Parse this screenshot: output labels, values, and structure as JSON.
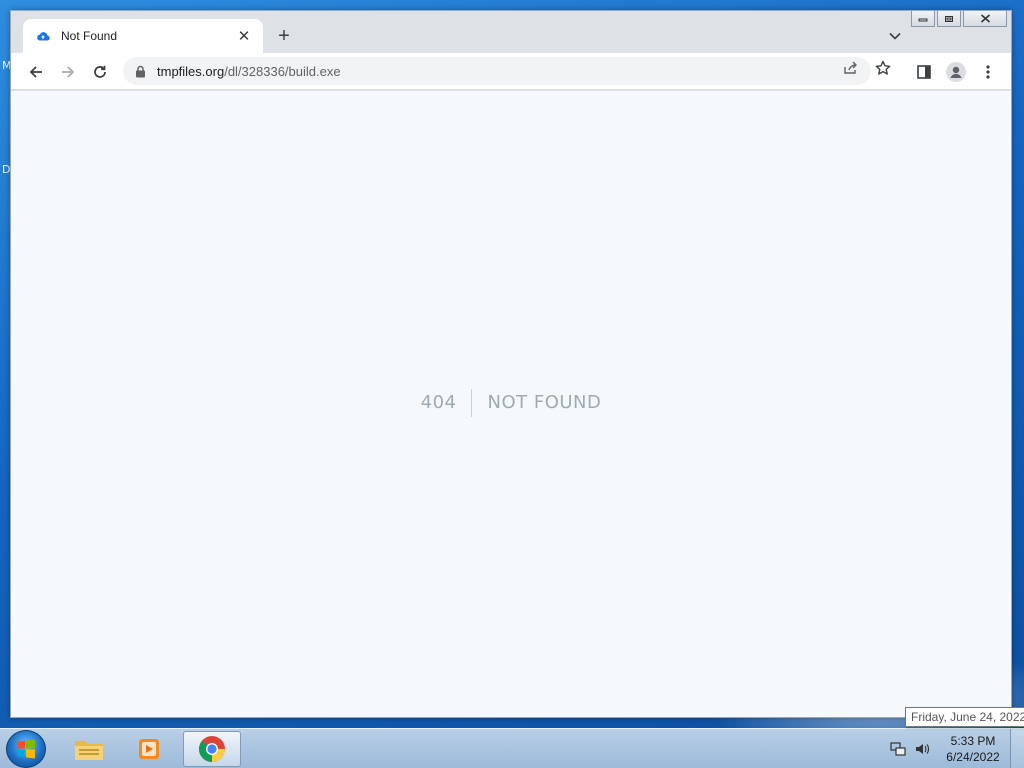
{
  "desktop": {
    "edge_text_1": "M",
    "edge_text_2": "D"
  },
  "browser": {
    "tab": {
      "title": "Not Found",
      "close_glyph": "✕",
      "favicon": "cloud-favicon-icon"
    },
    "new_tab_glyph": "+",
    "window_controls": [
      "minimize",
      "restore",
      "close"
    ],
    "omnibox": {
      "host": "tmpfiles.org",
      "path": "/dl/328336/build.exe"
    },
    "accent": "#1a73e8"
  },
  "page": {
    "code": "404",
    "message": "NOT FOUND"
  },
  "taskbar": {
    "items": [
      "start",
      "file-explorer",
      "media-player",
      "chrome"
    ],
    "active_item": "chrome",
    "clock": {
      "time": "5:33 PM",
      "date": "6/24/2022"
    },
    "tooltip": "Friday, June 24, 2022"
  }
}
